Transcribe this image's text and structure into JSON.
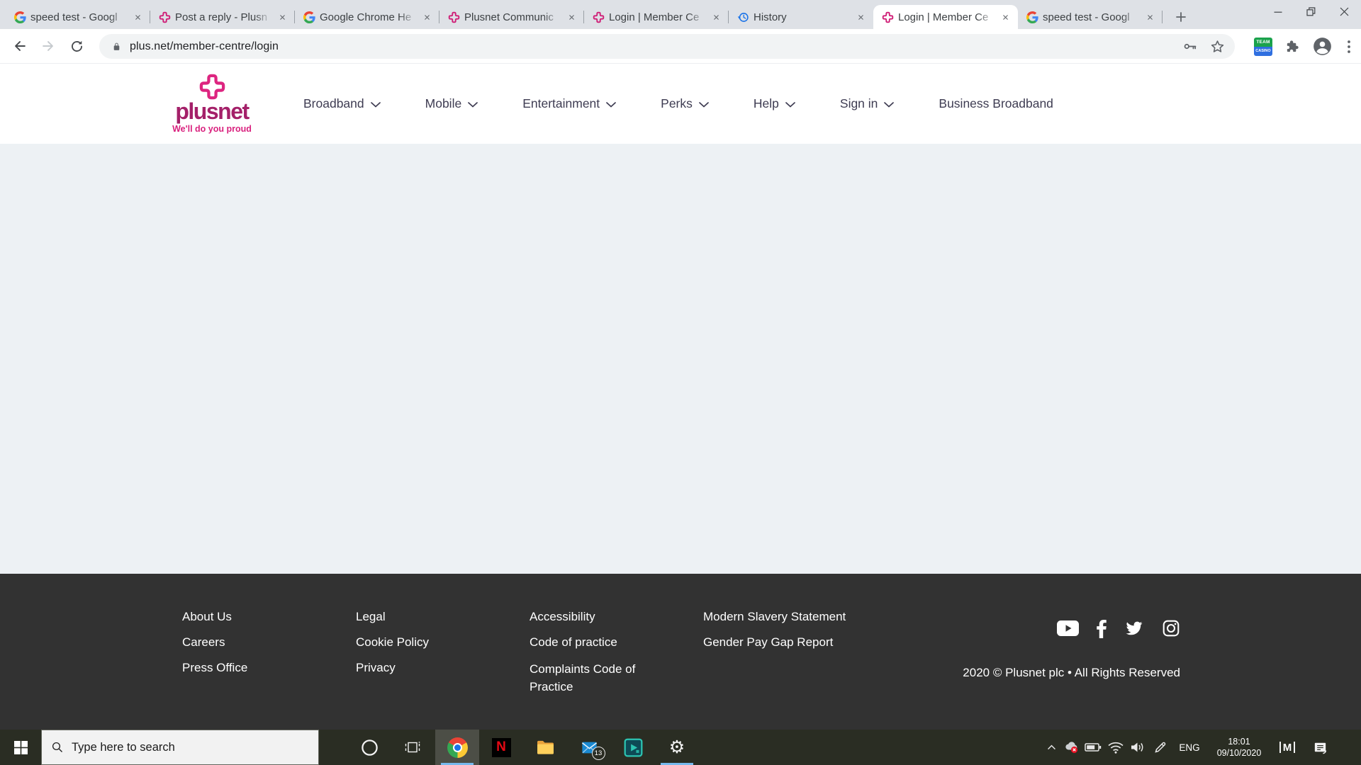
{
  "colors": {
    "brand_pink": "#d9217e",
    "brand_wordmark": "#a42069",
    "content_bg": "#edf1f4",
    "footer_bg": "#323232",
    "taskbar_bg": "#2a2d23",
    "taskbar_open_underline": "#76b9ed",
    "history_icon_blue": "#1a73e8"
  },
  "browser": {
    "tabs": [
      {
        "title": "speed test - Googl",
        "icon": "google-favicon"
      },
      {
        "title": "Post a reply - Plusn",
        "icon": "plusnet-favicon"
      },
      {
        "title": "Google Chrome He",
        "icon": "google-favicon"
      },
      {
        "title": "Plusnet Communic",
        "icon": "plusnet-favicon"
      },
      {
        "title": "Login | Member Ce",
        "icon": "plusnet-favicon"
      },
      {
        "title": "History",
        "icon": "history-icon"
      },
      {
        "title": "Login | Member Ce",
        "icon": "plusnet-favicon",
        "active": true
      },
      {
        "title": "speed test - Googl",
        "icon": "google-favicon"
      }
    ],
    "url": "plus.net/member-centre/login",
    "extension_badge": {
      "line1": "TEAM",
      "line2": "CASINO"
    }
  },
  "site": {
    "wordmark": "plusnet",
    "tagline": "We'll do you proud",
    "nav": [
      {
        "label": "Broadband"
      },
      {
        "label": "Mobile"
      },
      {
        "label": "Entertainment"
      },
      {
        "label": "Perks"
      },
      {
        "label": "Help"
      },
      {
        "label": "Sign in"
      },
      {
        "label": "Business Broadband",
        "chevron": false
      }
    ]
  },
  "footer": {
    "columns": [
      [
        "About Us",
        "Careers",
        "Press Office"
      ],
      [
        "Legal",
        "Cookie Policy",
        "Privacy"
      ],
      [
        "Accessibility",
        "Code of practice",
        "Complaints Code of Practice"
      ],
      [
        "Modern Slavery Statement",
        "Gender Pay Gap Report"
      ]
    ],
    "social": [
      "youtube",
      "facebook",
      "twitter",
      "instagram"
    ],
    "copyright": "2020 © Plusnet plc • All Rights Reserved"
  },
  "taskbar": {
    "search_placeholder": "Type here to search",
    "mail_badge": "13",
    "glyphs": {
      "netflix": "N",
      "settings": "⚙",
      "monogram": "M"
    },
    "language": "ENG",
    "time": "18:01",
    "date": "09/10/2020"
  }
}
